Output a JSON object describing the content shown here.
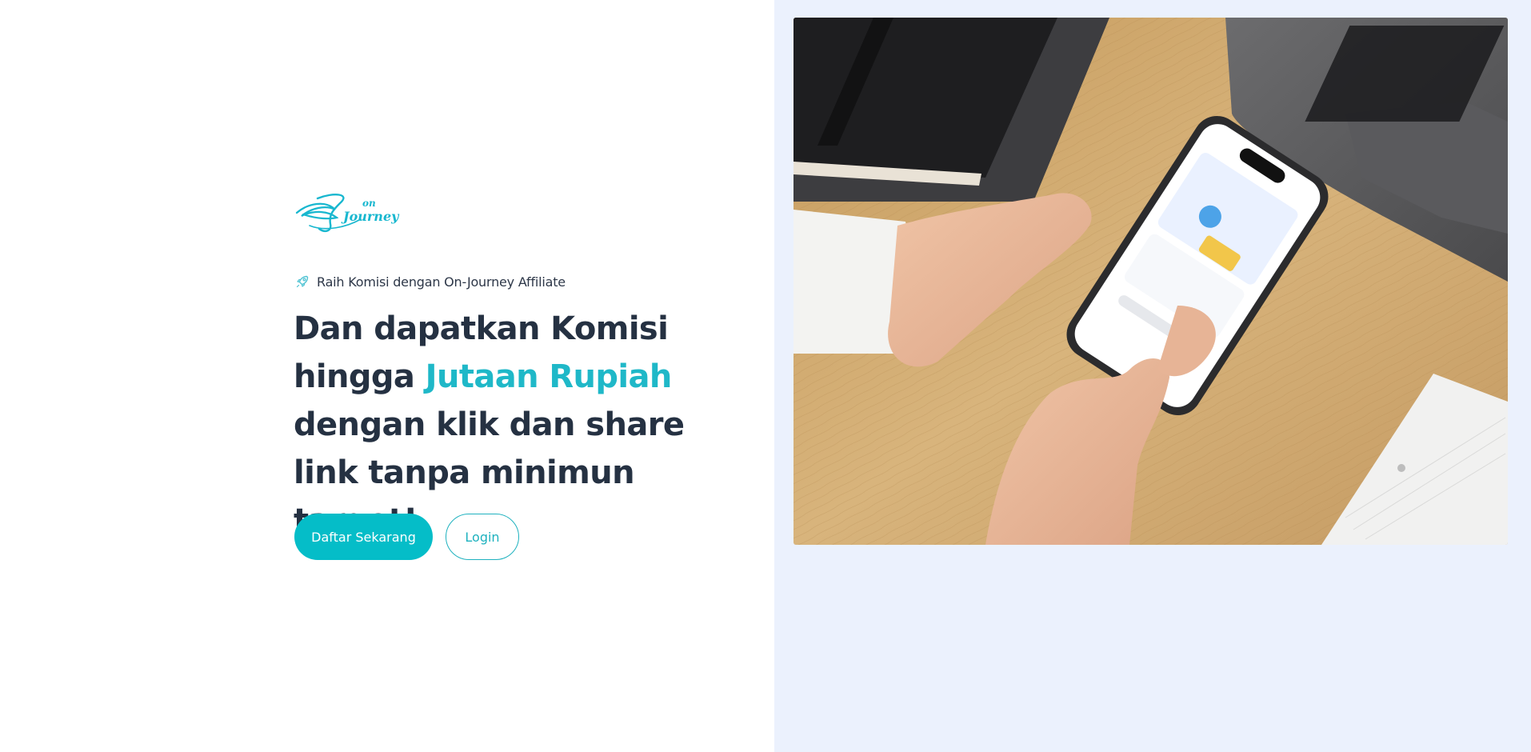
{
  "brand": {
    "name_top": "on",
    "name_bottom": "Journey"
  },
  "hero": {
    "eyebrow_text": "Raih Komisi dengan On-Journey Affiliate",
    "eyebrow_icon": "rocket-icon",
    "headline_part1": "Dan dapatkan Komisi hingga",
    "headline_accent": "Jutaan Rupiah",
    "headline_part2": "dengan klik dan share link tanpa minimun target!"
  },
  "actions": {
    "register_label": "Daftar Sekarang",
    "login_label": "Login"
  },
  "colors": {
    "accent": "#05bdc8",
    "heading": "#253142",
    "panel_background": "#ebf1fd"
  }
}
